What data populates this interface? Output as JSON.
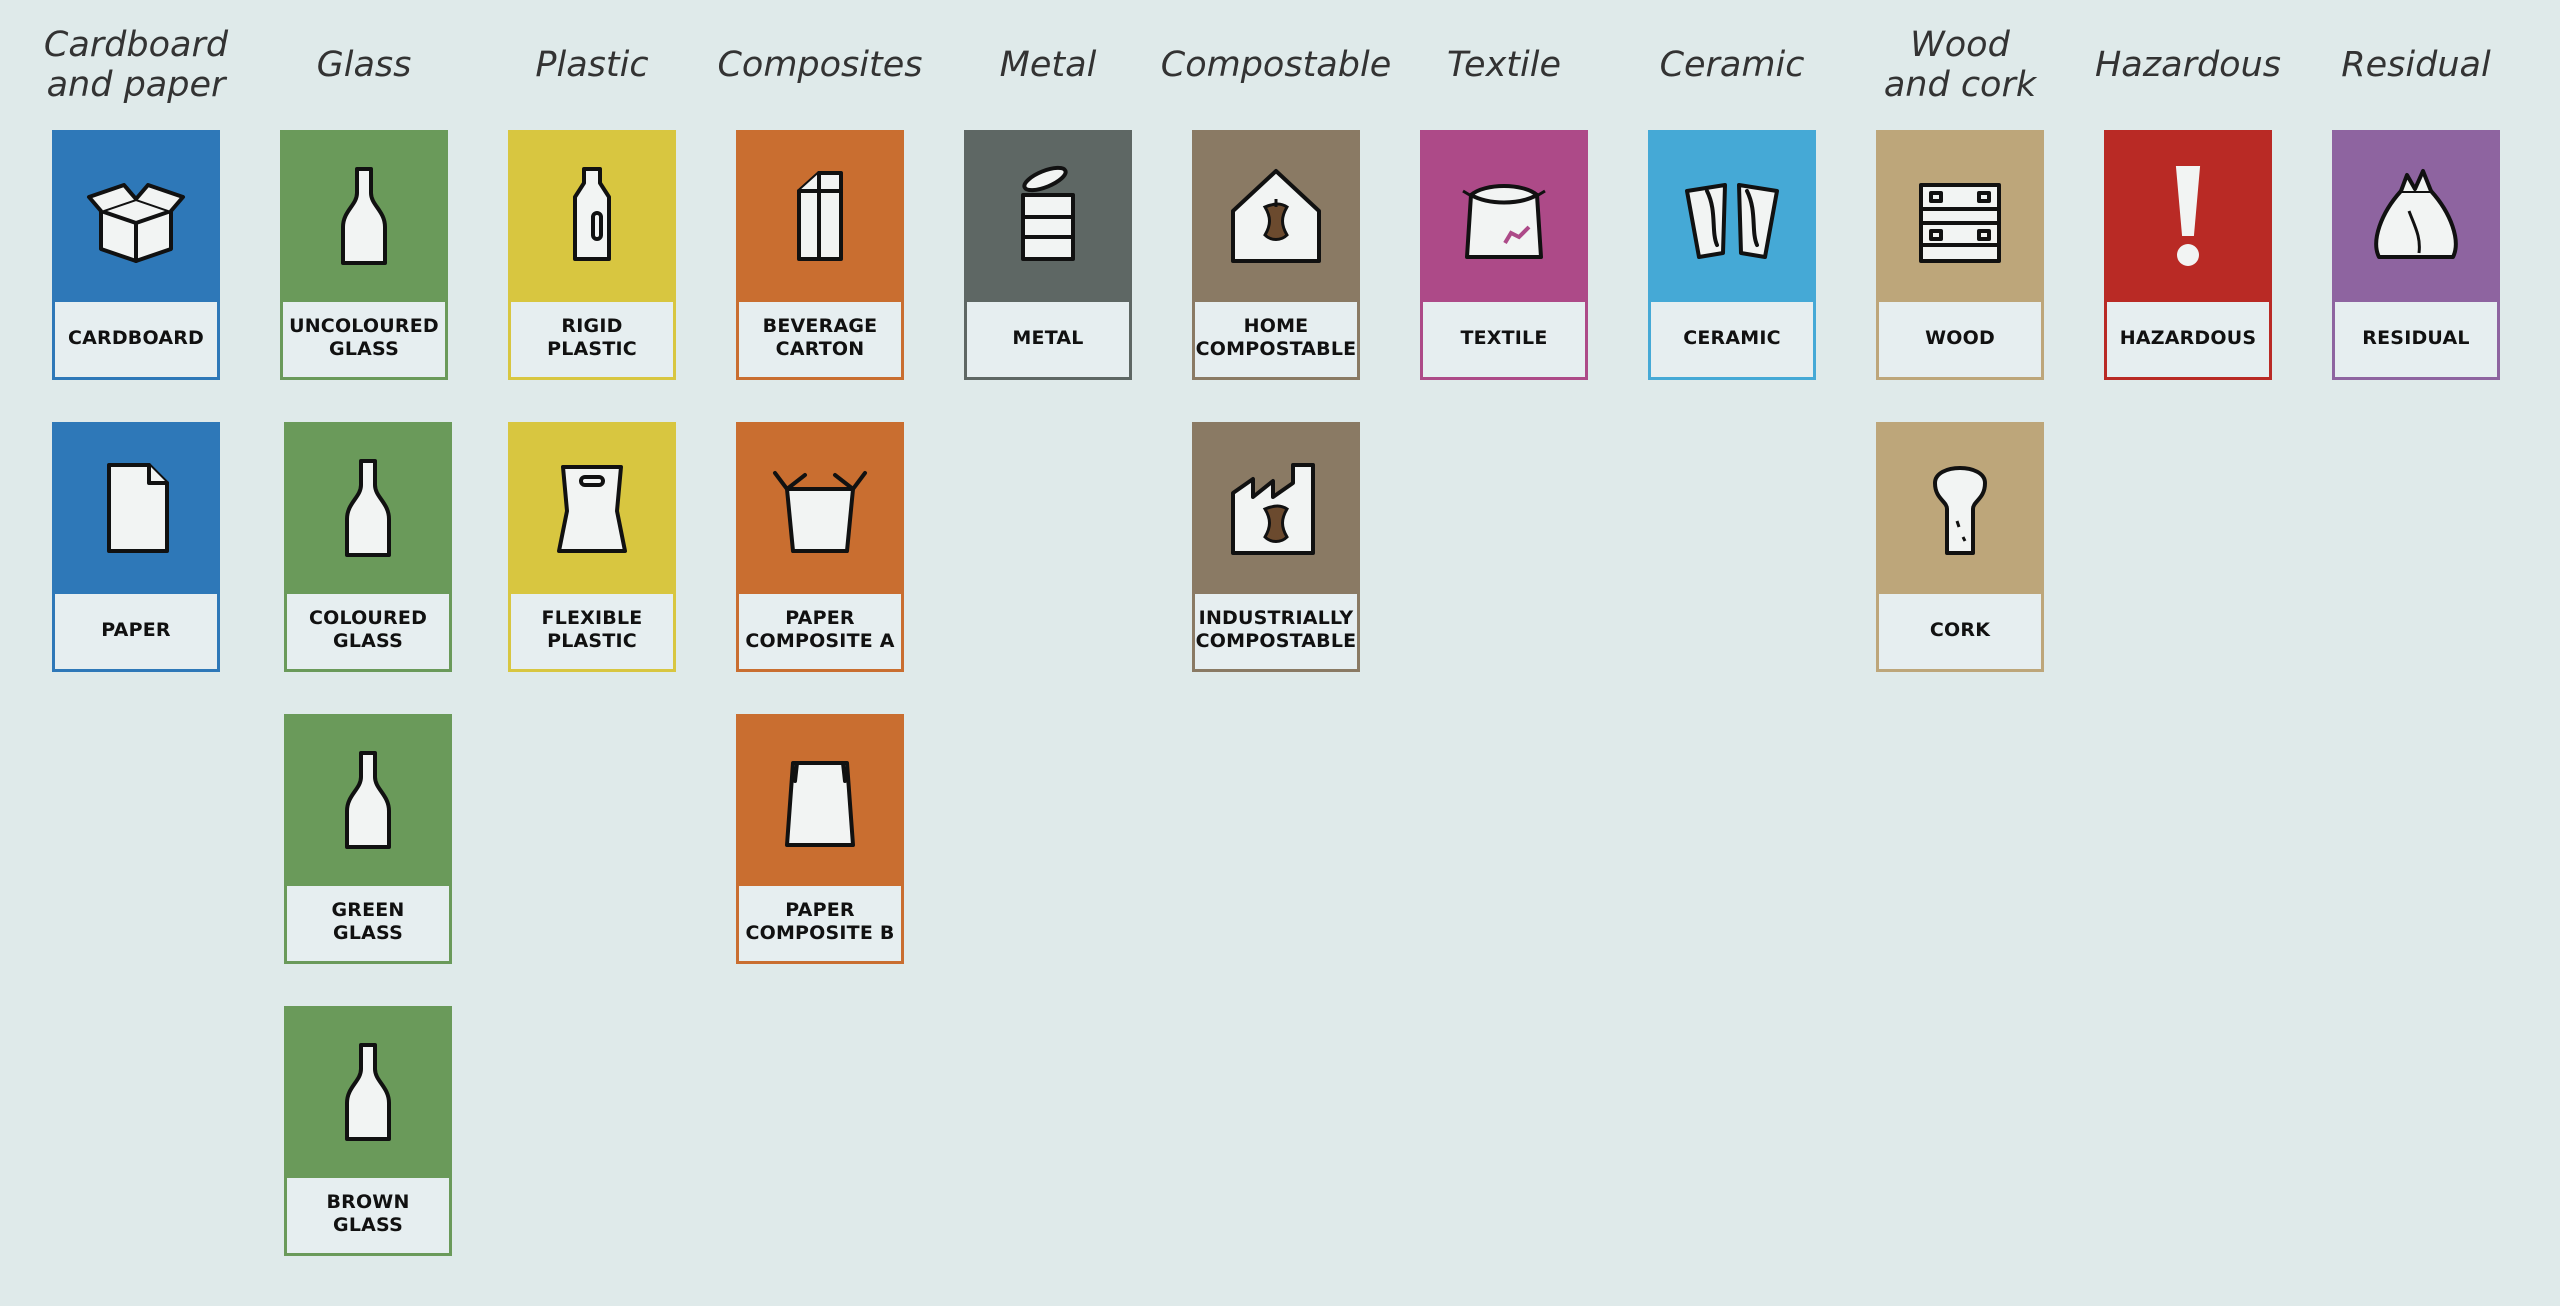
{
  "colors": {
    "background": "#dfeaea",
    "cardboard_paper": "#2e78b8",
    "glass": "#6a9a5a",
    "plastic": "#d8c640",
    "composites": "#c96e30",
    "metal": "#5e6764",
    "compostable": "#8a7a64",
    "textile": "#ad4a88",
    "ceramic": "#45a9d6",
    "wood_cork": "#bda67a",
    "hazardous": "#b92a25",
    "residual": "#8e64a0"
  },
  "categories": [
    {
      "key": "cardboard_paper",
      "title": "Cardboard\nand paper",
      "items": [
        {
          "label": "CARDBOARD",
          "icon": "box-icon"
        },
        {
          "label": "PAPER",
          "icon": "sheet-icon"
        }
      ]
    },
    {
      "key": "glass",
      "title": "Glass",
      "items": [
        {
          "label": "UNCOLOURED\nGLASS",
          "icon": "bottle-icon"
        },
        {
          "label": "COLOURED\nGLASS",
          "icon": "bottle-icon"
        },
        {
          "label": "GREEN\nGLASS",
          "icon": "bottle-icon"
        },
        {
          "label": "BROWN\nGLASS",
          "icon": "bottle-icon"
        }
      ]
    },
    {
      "key": "plastic",
      "title": "Plastic",
      "items": [
        {
          "label": "RIGID\nPLASTIC",
          "icon": "plastic-bottle-icon"
        },
        {
          "label": "FLEXIBLE\nPLASTIC",
          "icon": "plastic-bag-icon"
        }
      ]
    },
    {
      "key": "composites",
      "title": "Composites",
      "items": [
        {
          "label": "BEVERAGE\nCARTON",
          "icon": "carton-icon"
        },
        {
          "label": "PAPER\nCOMPOSITE A",
          "icon": "open-box-icon"
        },
        {
          "label": "PAPER\nCOMPOSITE B",
          "icon": "pouch-icon"
        }
      ]
    },
    {
      "key": "metal",
      "title": "Metal",
      "items": [
        {
          "label": "METAL",
          "icon": "can-icon"
        }
      ]
    },
    {
      "key": "compostable",
      "title": "Compostable",
      "items": [
        {
          "label": "HOME\nCOMPOSTABLE",
          "icon": "house-apple-icon"
        },
        {
          "label": "INDUSTRIALLY\nCOMPOSTABLE",
          "icon": "factory-apple-icon"
        }
      ]
    },
    {
      "key": "textile",
      "title": "Textile",
      "items": [
        {
          "label": "TEXTILE",
          "icon": "textile-bag-icon"
        }
      ]
    },
    {
      "key": "ceramic",
      "title": "Ceramic",
      "items": [
        {
          "label": "CERAMIC",
          "icon": "cups-icon"
        }
      ]
    },
    {
      "key": "wood_cork",
      "title": "Wood\nand cork",
      "items": [
        {
          "label": "WOOD",
          "icon": "crate-icon"
        },
        {
          "label": "CORK",
          "icon": "cork-icon"
        }
      ]
    },
    {
      "key": "hazardous",
      "title": "Hazardous",
      "items": [
        {
          "label": "HAZARDOUS",
          "icon": "exclamation-icon"
        }
      ]
    },
    {
      "key": "residual",
      "title": "Residual",
      "items": [
        {
          "label": "RESIDUAL",
          "icon": "trash-bag-icon"
        }
      ]
    }
  ]
}
